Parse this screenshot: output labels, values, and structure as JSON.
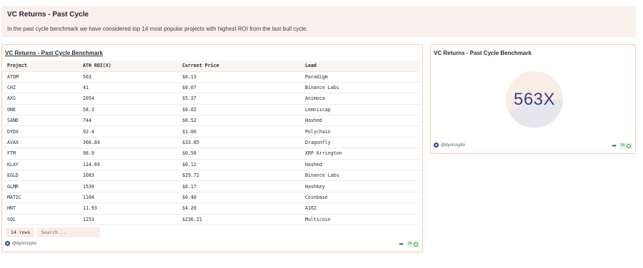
{
  "header": {
    "title": "VC Returns - Past Cycle",
    "description": "In the past cycle benchmark we have considered top 14 most popular projects with highest ROI from the last bull cycle."
  },
  "table_panel": {
    "title": "VC Returns - Past Cycle Benchmark",
    "columns": [
      "Project",
      "ATH ROI(X)",
      "Current Price",
      "Lead"
    ],
    "rows": [
      [
        "ATOM",
        "563",
        "$6.13",
        "Paradigm"
      ],
      [
        "CHZ",
        "41",
        "$0.07",
        "Binance Labs"
      ],
      [
        "AXS",
        "2054",
        "$5.37",
        "Animoca"
      ],
      [
        "ONE",
        "58.3",
        "$0.02",
        "Lemniscap"
      ],
      [
        "SAND",
        "744",
        "$0.52",
        "Hashed"
      ],
      [
        "DYDX",
        "92.4",
        "$1.06",
        "Polychain"
      ],
      [
        "AVAX",
        "366.84",
        "$33.85",
        "Dragonfly"
      ],
      [
        "FTM",
        "98.9",
        "$0.50",
        "XRP Arrington"
      ],
      [
        "KLAY",
        "114.69",
        "$0.12",
        "Hashed"
      ],
      [
        "EGLD",
        "1083",
        "$29.72",
        "Binance Labs"
      ],
      [
        "GLMR",
        "1539",
        "$0.17",
        "Hashkey"
      ],
      [
        "MATIC",
        "1104",
        "$0.40",
        "Coinbase"
      ],
      [
        "HNT",
        "11.93",
        "$4.20",
        "A16Z"
      ],
      [
        "SOL",
        "1153",
        "$236.21",
        "Multicoin"
      ]
    ],
    "row_count_label": "14 rows",
    "search_placeholder": "Search...",
    "author": "@dyorcrypto",
    "age": "9h"
  },
  "counter_panel": {
    "title": "VC Returns - Past Cycle Benchmark",
    "value": "563X",
    "author": "@dyorcrypto",
    "age": "9h"
  },
  "colors": {
    "header_bg": "#faf1ec",
    "panel_border": "#f2c9b4",
    "counter_text": "#3a3d8a",
    "badge_green": "#3d9a4c"
  }
}
